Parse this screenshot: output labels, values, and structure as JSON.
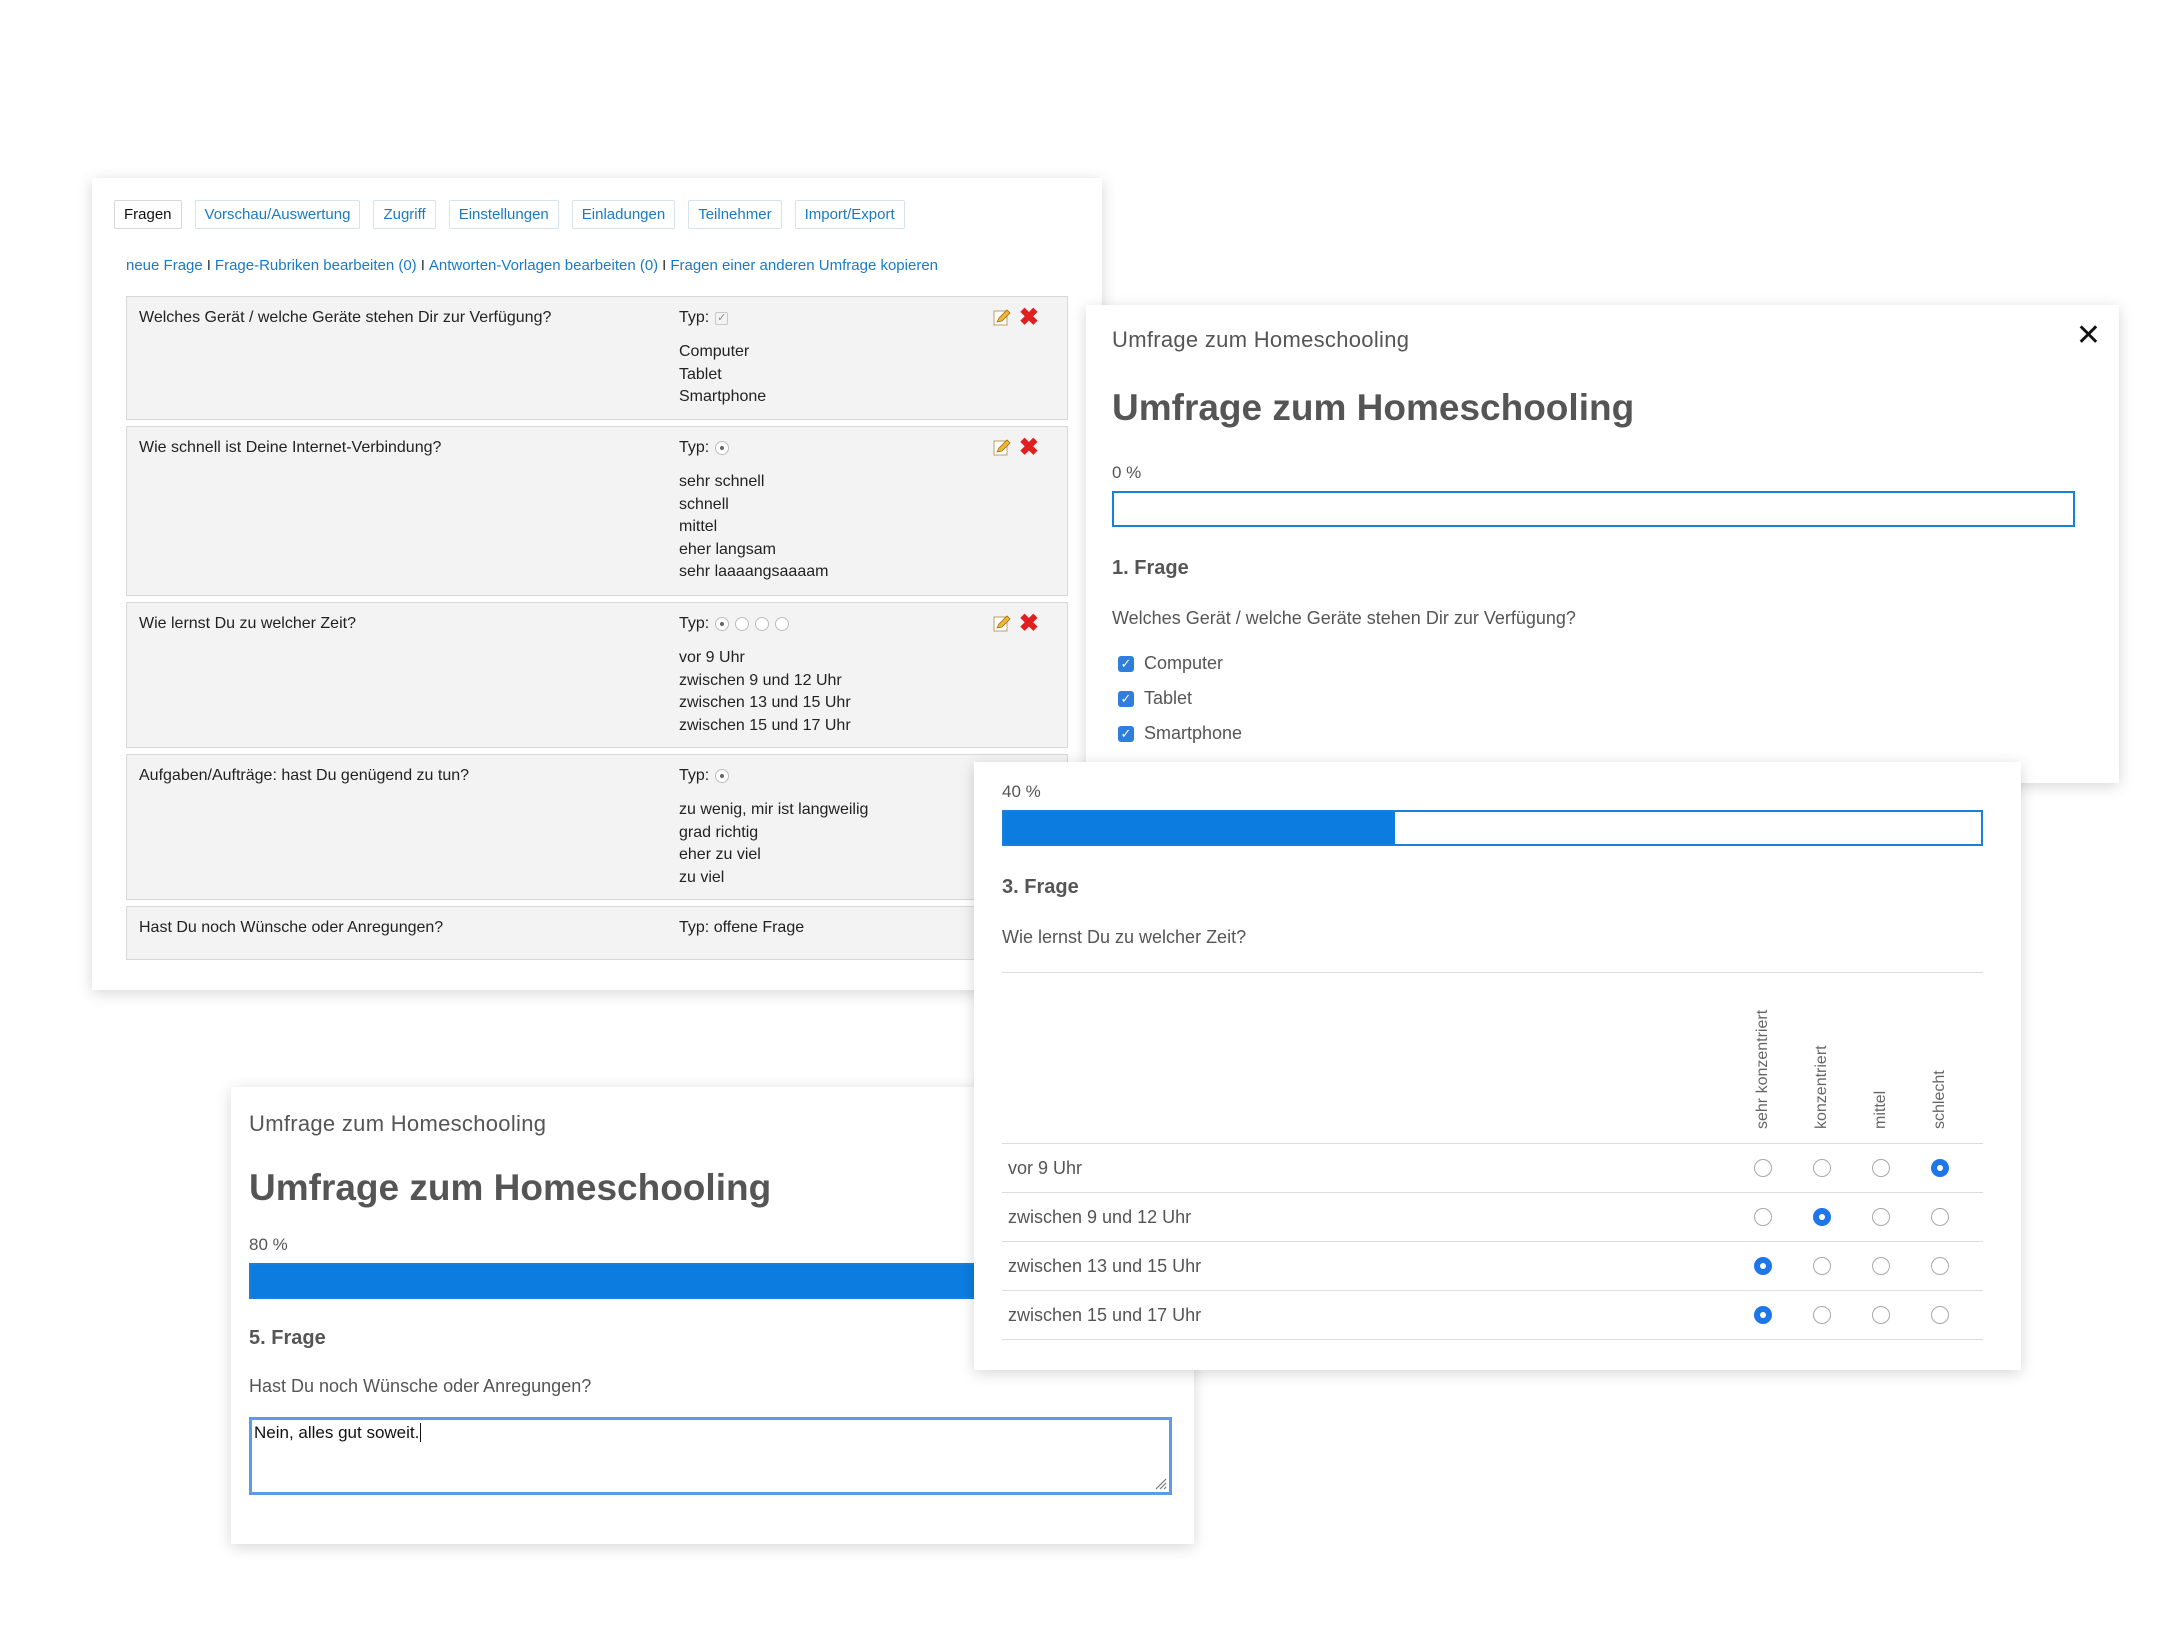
{
  "admin": {
    "tabs": [
      "Fragen",
      "Vorschau/Auswertung",
      "Zugriff",
      "Einstellungen",
      "Einladungen",
      "Teilnehmer",
      "Import/Export"
    ],
    "links": [
      "neue Frage",
      "Frage-Rubriken bearbeiten (0)",
      "Antworten-Vorlagen bearbeiten (0)",
      "Fragen einer anderen Umfrage kopieren"
    ],
    "link_separator": "I",
    "type_label": "Typ:",
    "questions": [
      {
        "text": "Welches Gerät / welche Geräte stehen Dir zur Verfügung?",
        "type_icon": "checkbox-icon",
        "options": [
          "Computer",
          "Tablet",
          "Smartphone"
        ]
      },
      {
        "text": "Wie schnell ist Deine Internet-Verbindung?",
        "type_icon": "radio-icon",
        "options": [
          "sehr schnell",
          "schnell",
          "mittel",
          "eher langsam",
          "sehr laaaangsaaaam"
        ]
      },
      {
        "text": "Wie lernst Du zu welcher Zeit?",
        "type_icon": "radio-matrix-icon",
        "options": [
          "vor 9 Uhr",
          "zwischen 9 und 12 Uhr",
          "zwischen 13 und 15 Uhr",
          "zwischen 15 und 17 Uhr"
        ]
      },
      {
        "text": "Aufgaben/Aufträge: hast Du genügend zu tun?",
        "type_icon": "radio-icon",
        "options": [
          "zu wenig, mir ist langweilig",
          "grad richtig",
          "eher zu viel",
          "zu viel"
        ]
      },
      {
        "text": "Hast Du noch Wünsche oder Anregungen?",
        "type_text": "offene Frage",
        "options": []
      }
    ]
  },
  "survey1": {
    "subtitle": "Umfrage zum Homeschooling",
    "title": "Umfrage zum Homeschooling",
    "progress_label": "0 %",
    "progress": 0,
    "question_number": "1. Frage",
    "question": "Welches Gerät / welche Geräte stehen Dir zur Verfügung?",
    "options": [
      {
        "label": "Computer",
        "checked": true
      },
      {
        "label": "Tablet",
        "checked": true
      },
      {
        "label": "Smartphone",
        "checked": true
      }
    ]
  },
  "survey2": {
    "progress_label": "40 %",
    "progress": 0.4,
    "question_number": "3. Frage",
    "question": "Wie lernst Du zu welcher Zeit?",
    "columns": [
      "sehr konzentriert",
      "konzentriert",
      "mittel",
      "schlecht"
    ],
    "rows": [
      {
        "label": "vor 9 Uhr",
        "selected": 3
      },
      {
        "label": "zwischen 9 und 12 Uhr",
        "selected": 1
      },
      {
        "label": "zwischen 13 und 15 Uhr",
        "selected": 0
      },
      {
        "label": "zwischen 15 und 17 Uhr",
        "selected": 0
      }
    ]
  },
  "survey3": {
    "subtitle": "Umfrage zum Homeschooling",
    "title": "Umfrage zum Homeschooling",
    "progress_label": "80 %",
    "progress": 0.8,
    "question_number": "5. Frage",
    "question": "Hast Du noch Wünsche oder Anregungen?",
    "answer": "Nein, alles gut soweit."
  },
  "colors": {
    "accent": "#0c7ce0",
    "link": "#1a7ac8",
    "delete": "#e02020"
  }
}
